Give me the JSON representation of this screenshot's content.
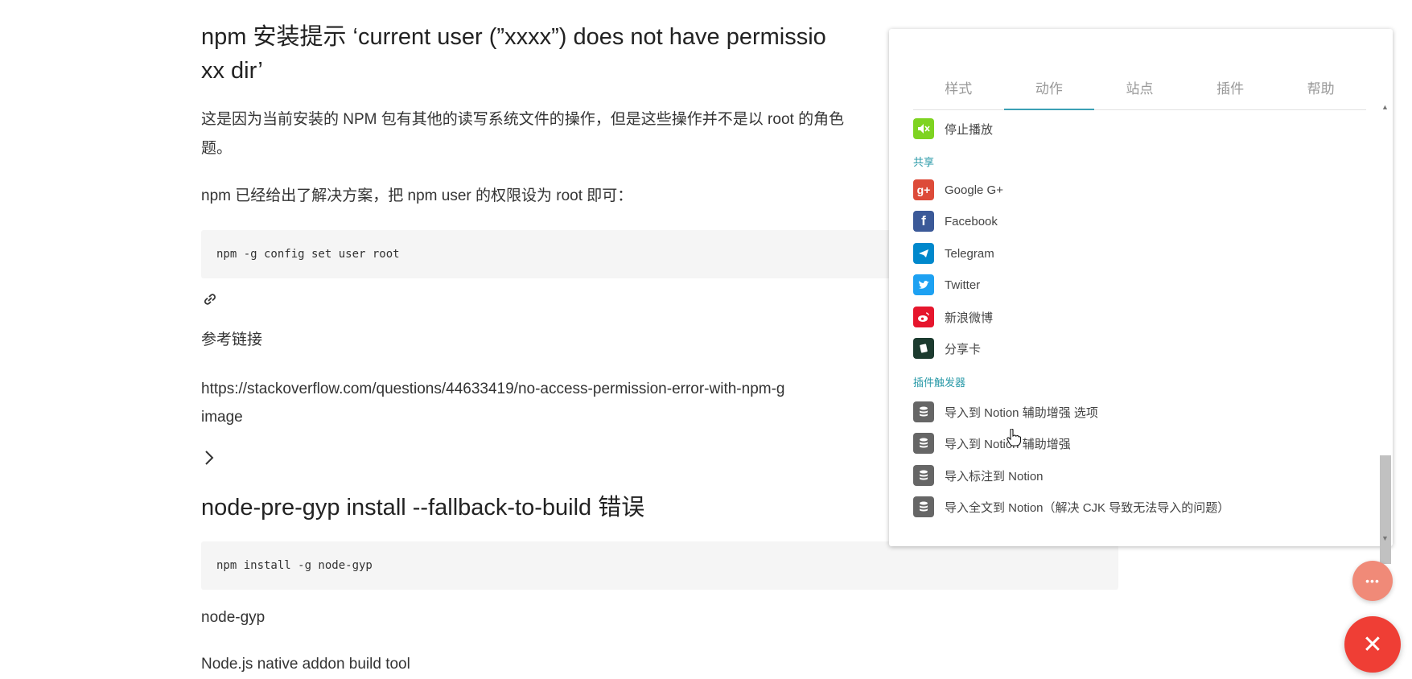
{
  "article": {
    "heading1": "npm 安装提示 ‘current user (”xxxx”) does not have permissio",
    "heading1_line2": "xx dir’",
    "para1_line1": "这是因为当前安装的 NPM 包有其他的读写系统文件的操作，但是这些操作并不是以 root 的角色",
    "para1_line2": "题。",
    "para2": "npm 已经给出了解决方案，把 npm user 的权限设为 root 即可：",
    "code1": "npm -g config set user root",
    "ref_label": "参考链接",
    "ref_url": "https://stackoverflow.com/questions/44633419/no-access-permission-error-with-npm-g",
    "image_text": "image",
    "heading2": "node-pre-gyp install --fallback-to-build 错误",
    "code2": "npm install -g node-gyp",
    "para3": "node-gyp",
    "para4": "Node.js native addon build tool"
  },
  "panel": {
    "tabs": [
      {
        "label": "样式",
        "active": false
      },
      {
        "label": "动作",
        "active": true
      },
      {
        "label": "站点",
        "active": false
      },
      {
        "label": "插件",
        "active": false
      },
      {
        "label": "帮助",
        "active": false
      }
    ],
    "stop_play": {
      "label": "停止播放",
      "icon": "mute-icon",
      "color": "#7ed321"
    },
    "share_section": "共享",
    "share_items": [
      {
        "label": "Google G+",
        "icon": "google-plus-icon",
        "color": "#dd4b39",
        "glyph": "g+"
      },
      {
        "label": "Facebook",
        "icon": "facebook-icon",
        "color": "#3b5998",
        "glyph": "f"
      },
      {
        "label": "Telegram",
        "icon": "telegram-icon",
        "color": "#0088cc",
        "glyph": "➤"
      },
      {
        "label": "Twitter",
        "icon": "twitter-icon",
        "color": "#1da1f2",
        "glyph": "t"
      },
      {
        "label": "新浪微博",
        "icon": "weibo-icon",
        "color": "#e6162d",
        "glyph": "微"
      },
      {
        "label": "分享卡",
        "icon": "share-card-icon",
        "color": "#1c3b2f",
        "glyph": "▮"
      }
    ],
    "plugin_section": "插件触发器",
    "plugin_items": [
      {
        "label": "导入到 Notion 辅助增强 选项",
        "icon": "database-icon",
        "color": "#666666"
      },
      {
        "label": "导入到 Notion 辅助增强",
        "icon": "database-icon",
        "color": "#666666"
      },
      {
        "label": "导入标注到 Notion",
        "icon": "database-icon",
        "color": "#666666"
      },
      {
        "label": "导入全文到 Notion（解决 CJK 导致无法导入的问题）",
        "icon": "database-icon",
        "color": "#666666"
      }
    ]
  },
  "fab": {
    "more_glyph": "•••",
    "close_glyph": "✕"
  }
}
